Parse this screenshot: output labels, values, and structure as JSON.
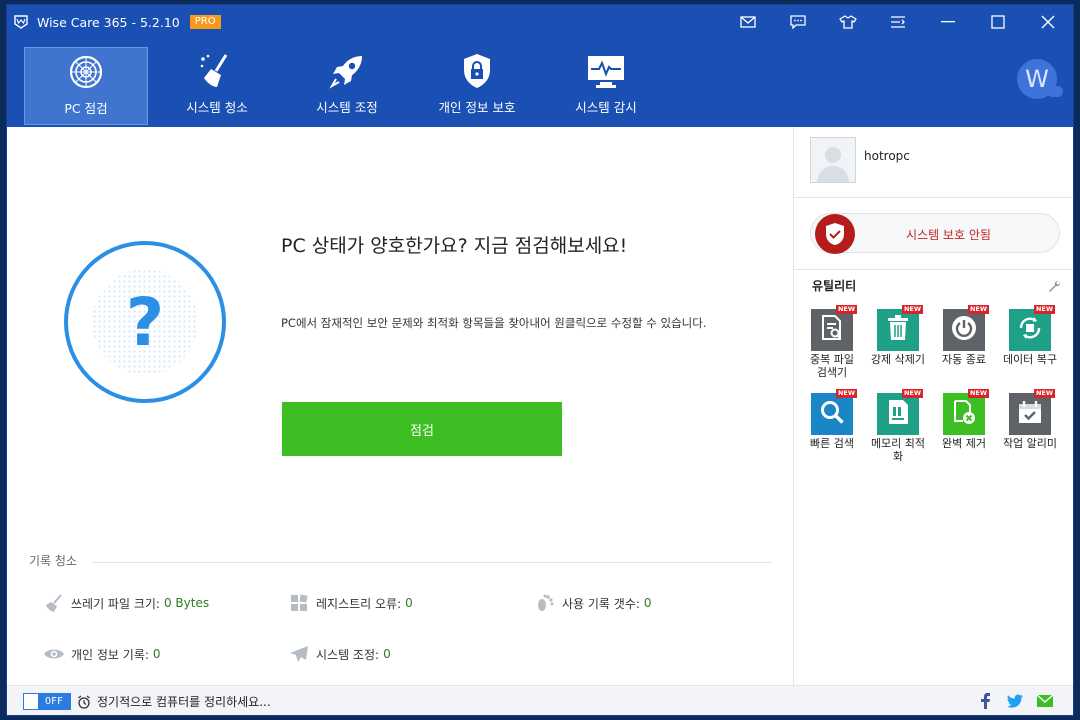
{
  "titlebar": {
    "title": "Wise Care 365 - 5.2.10",
    "badge": "PRO"
  },
  "nav": {
    "items": [
      {
        "label": "PC 점검",
        "icon": "radar-icon",
        "active": true
      },
      {
        "label": "시스템 청소",
        "icon": "broom-icon"
      },
      {
        "label": "시스템 조정",
        "icon": "rocket-icon"
      },
      {
        "label": "개인 정보 보호",
        "icon": "lock-shield-icon"
      },
      {
        "label": "시스템 감시",
        "icon": "monitor-pulse-icon"
      }
    ],
    "avatar_letter": "W"
  },
  "main": {
    "status_symbol": "?",
    "headline": "PC 상태가 양호한가요? 지금 점검해보세요!",
    "description": "PC에서 잠재적인 보안 문제와 최적화 항목들을 찾아내어 원클릭으로 수정할 수 있습니다.",
    "scan_button": "점검",
    "history_title": "기록 청소",
    "stats": [
      {
        "label": "쓰레기 파일 크기:",
        "value": "0 Bytes",
        "icon": "broom-icon"
      },
      {
        "label": "레지스트리 오류:",
        "value": "0",
        "icon": "registry-icon"
      },
      {
        "label": "사용 기록 갯수:",
        "value": "0",
        "icon": "footprint-icon"
      },
      {
        "label": "개인 정보 기록:",
        "value": "0",
        "icon": "eye-icon"
      },
      {
        "label": "시스템 조정:",
        "value": "0",
        "icon": "paper-plane-icon"
      }
    ]
  },
  "sidebar": {
    "username": "hotropc",
    "protection_status": "시스템 보호 안됨",
    "utilities_title": "유틸리티",
    "new_badge": "NEW",
    "utilities": [
      {
        "label": "중복 파일 검색기",
        "color": "#5f6368",
        "icon": "file-search-icon"
      },
      {
        "label": "강제 삭제기",
        "color": "#1fa187",
        "icon": "trash-icon"
      },
      {
        "label": "자동 종료",
        "color": "#5f6368",
        "icon": "power-icon"
      },
      {
        "label": "데이터 복구",
        "color": "#1fa187",
        "icon": "recover-icon"
      },
      {
        "label": "빠른 검색",
        "color": "#1a86c7",
        "icon": "magnifier-icon"
      },
      {
        "label": "메모리 최적화",
        "color": "#1fa187",
        "icon": "memory-icon"
      },
      {
        "label": "완벽 제거",
        "color": "#3dbf24",
        "icon": "uninstall-icon"
      },
      {
        "label": "작업 알리미",
        "color": "#5f6368",
        "icon": "calendar-check-icon"
      }
    ]
  },
  "footer": {
    "toggle_state": "OFF",
    "reminder_text": "정기적으로 컴퓨터를 정리하세요..."
  },
  "colors": {
    "brand_blue": "#1a4fb3",
    "scan_green": "#3dbf24",
    "alert_red": "#c0281f",
    "accent_blue": "#2b8fe6"
  }
}
